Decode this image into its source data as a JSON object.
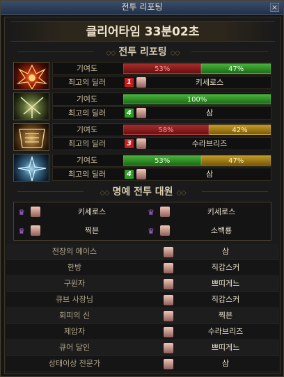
{
  "window": {
    "title": "전투 리포팅",
    "close_label": "×"
  },
  "clear_time": "클리어타임  33분02초",
  "report_heading": "전투 리포팅",
  "honor_heading": "명예 전투 대원",
  "row_labels": {
    "contribution": "기여도",
    "best_dealer": "최고의 딜러"
  },
  "colors": {
    "red": "#a22c2c",
    "green": "#2f9a25",
    "yellow": "#b8901c"
  },
  "bosses": [
    {
      "icon": "red-boss-icon",
      "segments": [
        {
          "label": "53%",
          "value": 53,
          "color": "red"
        },
        {
          "label": "47%",
          "value": 47,
          "color": "green"
        }
      ],
      "rank": "1",
      "rank_color": "red",
      "dealer": "키세로스"
    },
    {
      "icon": "green-boss-icon",
      "segments": [
        {
          "label": "100%",
          "value": 100,
          "color": "green"
        }
      ],
      "rank": "4",
      "rank_color": "green",
      "dealer": "삼"
    },
    {
      "icon": "gold-boss-icon",
      "segments": [
        {
          "label": "58%",
          "value": 58,
          "color": "red"
        },
        {
          "label": "42%",
          "value": 42,
          "color": "yellow"
        }
      ],
      "rank": "3",
      "rank_color": "red",
      "dealer": "수라브리즈"
    },
    {
      "icon": "blue-boss-icon",
      "segments": [
        {
          "label": "53%",
          "value": 53,
          "color": "green"
        },
        {
          "label": "47%",
          "value": 47,
          "color": "yellow"
        }
      ],
      "rank": "4",
      "rank_color": "green",
      "dealer": "삼"
    }
  ],
  "honor_members": [
    {
      "name": "키세로스"
    },
    {
      "name": "키세로스"
    },
    {
      "name": "찍븐"
    },
    {
      "name": "소백룡"
    }
  ],
  "titles": [
    {
      "title": "전장의 에이스",
      "name": "삼"
    },
    {
      "title": "한방",
      "name": "직갑스커"
    },
    {
      "title": "구원자",
      "name": "쁘띠게느"
    },
    {
      "title": "큐브 사장님",
      "name": "직갑스커"
    },
    {
      "title": "회피의 신",
      "name": "찍븐"
    },
    {
      "title": "제압자",
      "name": "수라브리즈"
    },
    {
      "title": "큐어 달인",
      "name": "쁘띠게느"
    },
    {
      "title": "상태이상 전문가",
      "name": "삼"
    }
  ]
}
